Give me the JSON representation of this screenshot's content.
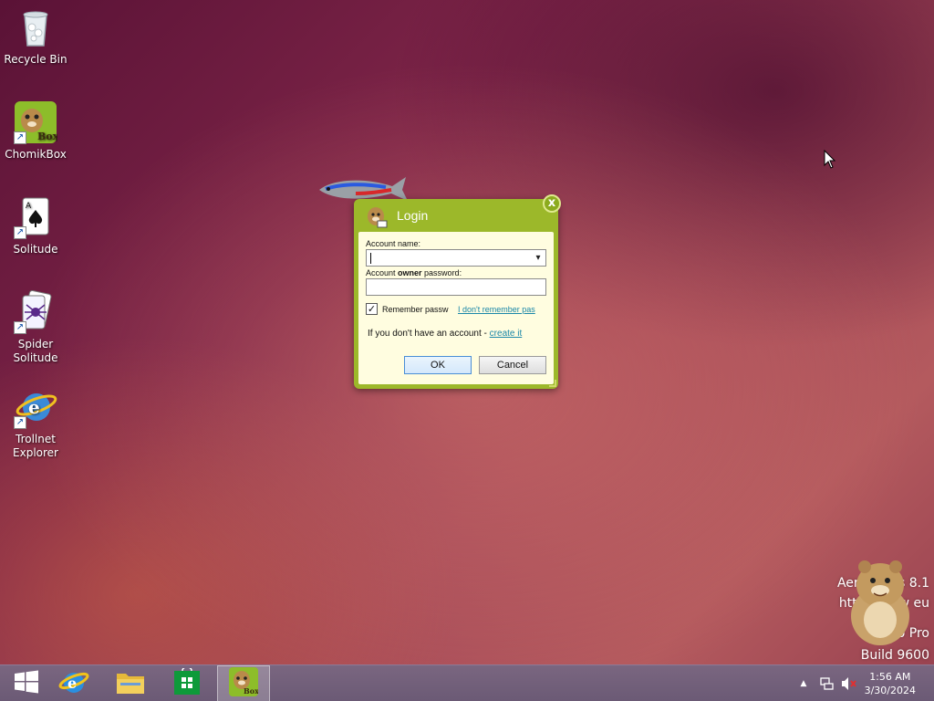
{
  "desktop": {
    "icons": [
      {
        "label": "Recycle Bin"
      },
      {
        "label": "ChomikBox"
      },
      {
        "label": "Solitude"
      },
      {
        "label": "Spider Solitude"
      },
      {
        "label": "Trollnet Explorer"
      }
    ]
  },
  "login_dialog": {
    "title": "Login",
    "close_label": "x",
    "account_name_label": "Account name:",
    "account_name_value": "",
    "password_label_prefix": "Account ",
    "password_label_bold": "owner",
    "password_label_suffix": " password:",
    "password_value": "",
    "remember_label": "Remember passw",
    "remember_checked": true,
    "forgot_link": "I don't remember pas",
    "no_account_text": "If you don't have an account - ",
    "create_link": "create it",
    "ok_label": "OK",
    "cancel_label": "Cancel",
    "accent_color": "#9cb82a"
  },
  "watermark": {
    "line1": "Aero Glass          8.1",
    "line2": "http://www              eu",
    "line3": "Windo          Pro",
    "line4": "Build 9600"
  },
  "taskbar": {
    "items": [
      {
        "name": "start",
        "icon": "windows-logo-icon"
      },
      {
        "name": "internet-explorer",
        "icon": "ie-icon"
      },
      {
        "name": "file-explorer",
        "icon": "folder-icon"
      },
      {
        "name": "store",
        "icon": "store-icon"
      },
      {
        "name": "chomikbox",
        "icon": "chomikbox-icon",
        "active": true
      }
    ],
    "time": "1:56 AM",
    "date": "3/30/2024"
  }
}
